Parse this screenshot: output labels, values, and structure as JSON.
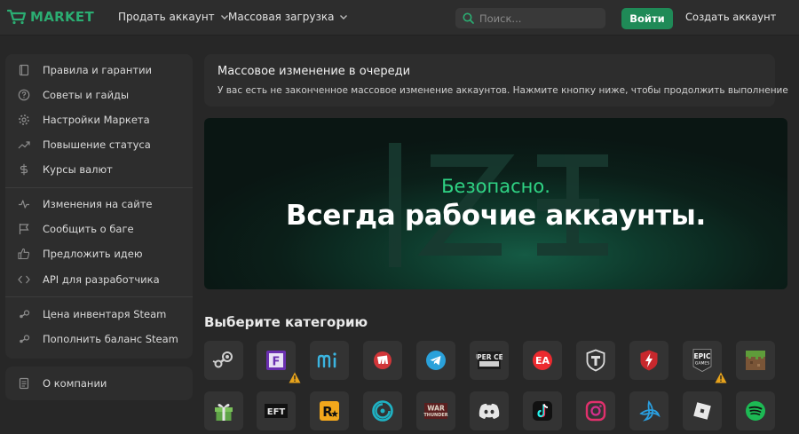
{
  "header": {
    "logo_text": "MARKET",
    "nav": [
      {
        "label": "Продать аккаунт"
      },
      {
        "label": "Массовая загрузка"
      }
    ],
    "search_placeholder": "Поиск...",
    "login_label": "Войти",
    "signup_label": "Создать аккаунт"
  },
  "sidebar": {
    "items": [
      {
        "label": "Правила и гарантии",
        "icon": "book-icon"
      },
      {
        "label": "Советы и гайды",
        "icon": "help-circle-icon"
      },
      {
        "label": "Настройки Маркета",
        "icon": "gear-icon"
      },
      {
        "label": "Повышение статуса",
        "icon": "trending-up-icon"
      },
      {
        "label": "Курсы валют",
        "icon": "dollar-icon"
      },
      {
        "label": "Изменения на сайте",
        "icon": "activity-icon"
      },
      {
        "label": "Сообщить о баге",
        "icon": "flag-icon"
      },
      {
        "label": "Предложить идею",
        "icon": "thumbs-up-icon"
      },
      {
        "label": "API для разработчика",
        "icon": "code-icon"
      },
      {
        "label": "Цена инвентаря Steam",
        "icon": "steam-icon"
      },
      {
        "label": "Пополнить баланс Steam",
        "icon": "steam-icon"
      }
    ],
    "about_label": "О компании"
  },
  "notice": {
    "title": "Массовое изменение в очереди",
    "text": "У вас есть не законченное массовое изменение аккаунтов. Нажмите кнопку ниже, чтобы продолжить выполнение"
  },
  "banner": {
    "subtitle": "Безопасно.",
    "headline": "Всегда рабочие аккаунты."
  },
  "categories": {
    "title": "Выберите категорию",
    "row1": [
      {
        "icon": "steam-icon"
      },
      {
        "icon": "fortnite-icon",
        "warning": true
      },
      {
        "icon": "mihoyo-icon"
      },
      {
        "icon": "riot-icon"
      },
      {
        "icon": "telegram-icon"
      },
      {
        "icon": "supercell-icon"
      },
      {
        "icon": "ea-icon"
      },
      {
        "icon": "world-of-tanks-icon"
      },
      {
        "icon": "wot-blitz-icon"
      },
      {
        "icon": "epic-games-icon",
        "warning": true
      },
      {
        "icon": "minecraft-icon"
      }
    ],
    "row2": [
      {
        "icon": "gift-icon"
      },
      {
        "icon": "escape-from-tarkov-icon"
      },
      {
        "icon": "rockstar-icon"
      },
      {
        "icon": "ubisoft-icon"
      },
      {
        "icon": "war-thunder-icon"
      },
      {
        "icon": "discord-icon"
      },
      {
        "icon": "tiktok-icon"
      },
      {
        "icon": "instagram-icon"
      },
      {
        "icon": "battlenet-icon"
      },
      {
        "icon": "roblox-icon"
      },
      {
        "icon": "spotify-icon"
      }
    ],
    "epic_text": "EPIC",
    "epic_sub": "GAMES",
    "eft_text": "EFT",
    "wt_text_1": "WAR",
    "wt_text_2": "THUNDER",
    "supercell_text": "SUPER CELL",
    "ea_text": "EA",
    "fortnite_text": "F",
    "rockstar_text": "R"
  },
  "colors": {
    "accent": "#2bad72",
    "login_button": "#1f8a57",
    "banner_subtitle": "#2fd384",
    "background": "#272727",
    "panel": "#2d2d2d",
    "tile": "#333333"
  }
}
